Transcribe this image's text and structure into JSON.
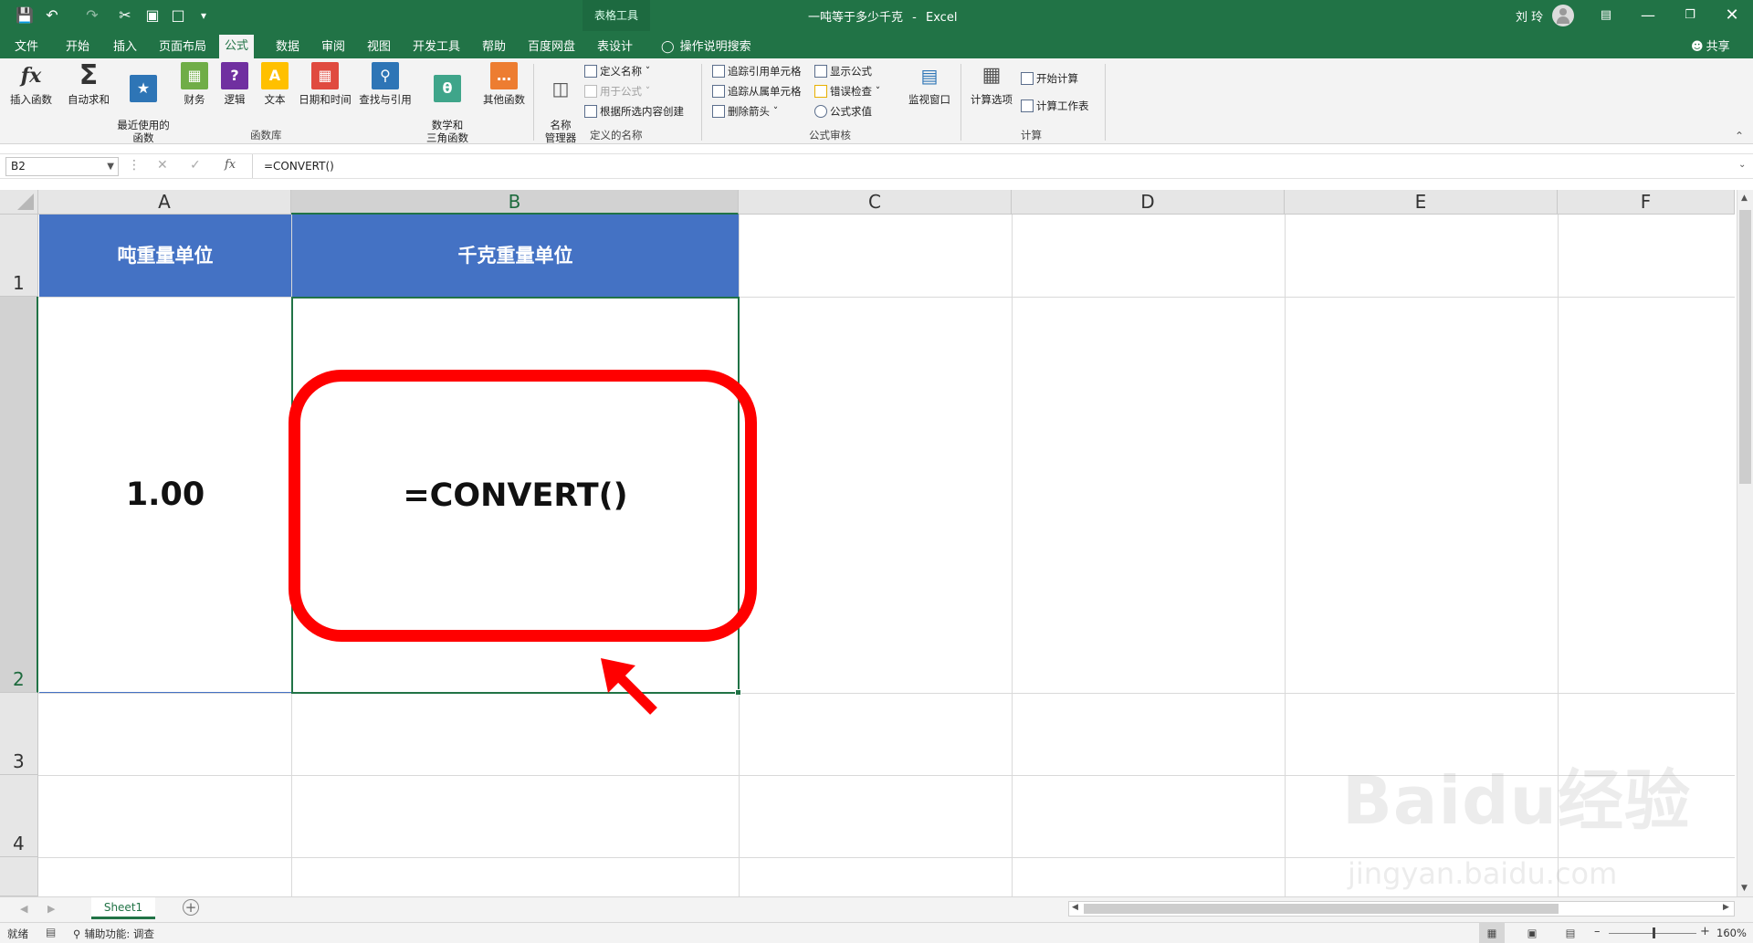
{
  "window": {
    "doc_title": "一吨等于多少千克",
    "separator": "-",
    "app_name": "Excel",
    "context_group": "表格工具",
    "user_name": "刘 玲",
    "share_label": "共享"
  },
  "tabs": [
    "文件",
    "开始",
    "插入",
    "页面布局",
    "公式",
    "数据",
    "审阅",
    "视图",
    "开发工具",
    "帮助",
    "百度网盘",
    "表设计"
  ],
  "active_tab": "公式",
  "tell_me": "操作说明搜索",
  "ribbon": {
    "function_library": {
      "group_label": "函数库",
      "buttons": [
        {
          "label": "插入函数",
          "icon": "fx-icon"
        },
        {
          "label": "自动求和",
          "icon": "sigma-icon"
        },
        {
          "label": "最近使用的\n函数",
          "icon": "star-book-icon"
        },
        {
          "label": "财务",
          "icon": "finance-book-icon"
        },
        {
          "label": "逻辑",
          "icon": "logic-book-icon"
        },
        {
          "label": "文本",
          "icon": "text-book-icon"
        },
        {
          "label": "日期和时间",
          "icon": "date-book-icon"
        },
        {
          "label": "查找与引用",
          "icon": "lookup-book-icon"
        },
        {
          "label": "数学和\n三角函数",
          "icon": "math-book-icon"
        },
        {
          "label": "其他函数",
          "icon": "more-book-icon"
        }
      ]
    },
    "defined_names": {
      "group_label": "定义的名称",
      "manager_label": "名称\n管理器",
      "items": [
        "定义名称",
        "用于公式",
        "根据所选内容创建"
      ]
    },
    "formula_auditing": {
      "group_label": "公式审核",
      "items": [
        "追踪引用单元格",
        "追踪从属单元格",
        "删除箭头",
        "显示公式",
        "错误检查",
        "公式求值"
      ],
      "watch_label": "监视窗口"
    },
    "calculation": {
      "group_label": "计算",
      "options_label": "计算选项",
      "items": [
        "开始计算",
        "计算工作表"
      ]
    }
  },
  "formula_bar": {
    "name_box": "B2",
    "fx": "fx",
    "formula": "=CONVERT()"
  },
  "sheet": {
    "columns": [
      "A",
      "B",
      "C",
      "D",
      "E",
      "F"
    ],
    "rows": [
      "1",
      "2",
      "3",
      "4"
    ],
    "header_a1": "吨重量单位",
    "header_b1": "千克重量单位",
    "value_a2": "1.00",
    "value_b2": "=CONVERT()",
    "selected_cell": "B2"
  },
  "sheet_tabs": [
    "Sheet1"
  ],
  "status": {
    "ready": "就绪",
    "accessibility": "辅助功能: 调查",
    "zoom": "160%"
  },
  "watermark": {
    "brand": "Baidu经验",
    "url": "jingyan.baidu.com"
  },
  "colors": {
    "excel_green": "#217346",
    "table_header_blue": "#4472c4",
    "annotation_red": "#ff0000"
  }
}
